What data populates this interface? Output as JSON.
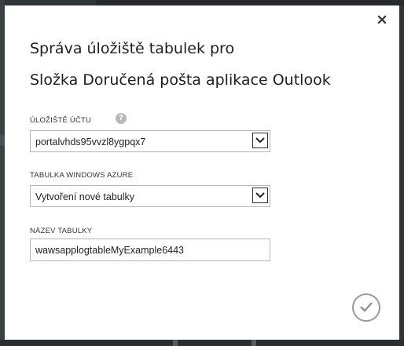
{
  "dialog": {
    "title_line1": "Správa úložiště tabulek pro",
    "title_line2": "Složka Doručená pošta aplikace Outlook",
    "close_icon": "close-icon",
    "ok_icon": "checkmark-icon"
  },
  "fields": {
    "storage_account": {
      "label": "ÚLOŽIŠTĚ ÚČTU",
      "help": "?",
      "value": "portalvhds95vvzl8ygpqx7"
    },
    "azure_table": {
      "label": "TABULKA WINDOWS AZURE",
      "value": "Vytvoření nové tabulky"
    },
    "table_name": {
      "label": "NÁZEV TABULKY",
      "value": "wawsapplogtableMyExample6443"
    }
  },
  "colors": {
    "backdrop": "#2f3437",
    "dialog_bg": "#ffffff",
    "field_border": "#b5b5b5",
    "help_icon": "#b9b9b9",
    "ok_ring": "#9a9a9a"
  }
}
